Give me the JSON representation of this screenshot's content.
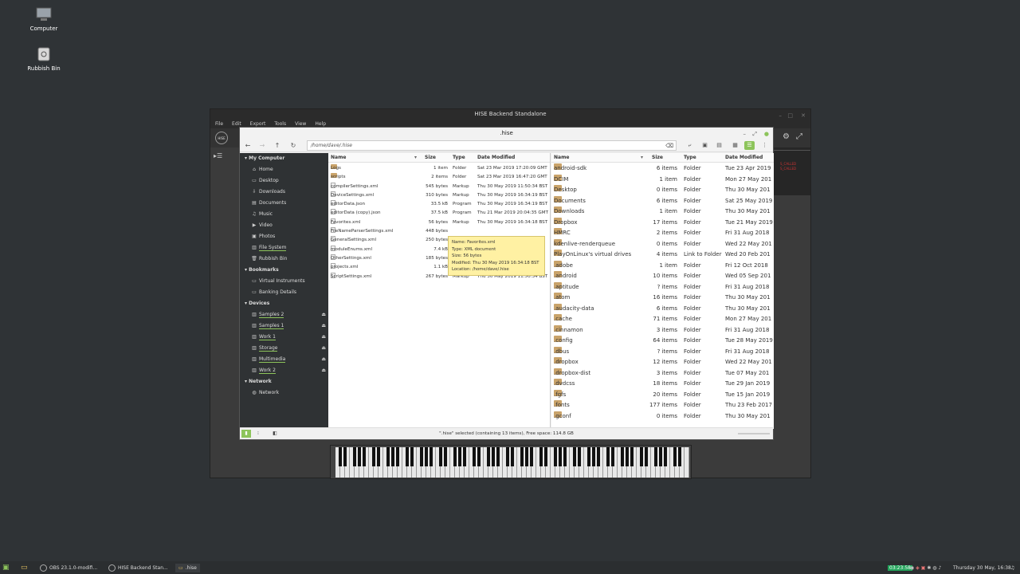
{
  "desktop": {
    "icons": [
      {
        "label": "Computer",
        "icon": "computer-icon"
      },
      {
        "label": "Rubbish Bin",
        "icon": "trash-icon"
      }
    ]
  },
  "hise": {
    "title": "HISE Backend Standalone",
    "menu": [
      "File",
      "Edit",
      "Export",
      "Tools",
      "View",
      "Help"
    ],
    "logo": "HISE",
    "console": [
      "S_CALLED",
      "S_CALLED"
    ]
  },
  "fm": {
    "title": ".hise",
    "location": "/home/dave/.hise",
    "sidebar": {
      "my_computer": "My Computer",
      "places": [
        {
          "label": "Home",
          "icon": "home-icon"
        },
        {
          "label": "Desktop",
          "icon": "desktop-icon"
        },
        {
          "label": "Downloads",
          "icon": "download-icon"
        },
        {
          "label": "Documents",
          "icon": "document-icon"
        },
        {
          "label": "Music",
          "icon": "music-icon"
        },
        {
          "label": "Video",
          "icon": "video-icon"
        },
        {
          "label": "Photos",
          "icon": "photo-icon"
        },
        {
          "label": "File System",
          "icon": "drive-icon"
        },
        {
          "label": "Rubbish Bin",
          "icon": "trash-icon"
        }
      ],
      "bookmarks_head": "Bookmarks",
      "bookmarks": [
        "Virtual Instruments",
        "Banking Details"
      ],
      "devices_head": "Devices",
      "devices": [
        "Samples 2",
        "Samples 1",
        "Work 1",
        "Storage",
        "Multimedia",
        "Work 2"
      ],
      "network_head": "Network",
      "network": [
        "Network"
      ]
    },
    "left_columns": {
      "name": "Name",
      "size": "Size",
      "type": "Type",
      "date": "Date Modified"
    },
    "left_rows": [
      {
        "name": "Logs",
        "size": "1 item",
        "type": "Folder",
        "date": "Sat 23 Mar 2019 17:20:09 GMT",
        "folder": true
      },
      {
        "name": "scripts",
        "size": "2 items",
        "type": "Folder",
        "date": "Sat 23 Mar 2019 16:47:20 GMT",
        "folder": true
      },
      {
        "name": "compilerSettings.xml",
        "size": "545 bytes",
        "type": "Markup",
        "date": "Thu 30 May 2019 11:50:34 BST"
      },
      {
        "name": "DeviceSettings.xml",
        "size": "310 bytes",
        "type": "Markup",
        "date": "Thu 30 May 2019 16:34:19 BST"
      },
      {
        "name": "editorData.json",
        "size": "33.5 kB",
        "type": "Program",
        "date": "Thu 30 May 2019 16:34:19 BST"
      },
      {
        "name": "editorData (copy).json",
        "size": "37.5 kB",
        "type": "Program",
        "date": "Thu 21 Mar 2019 20:04:35 GMT"
      },
      {
        "name": "Favorites.xml",
        "size": "56 bytes",
        "type": "Markup",
        "date": "Thu 30 May 2019 16:34:18 BST"
      },
      {
        "name": "FileNameParserSettings.xml",
        "size": "448 bytes",
        "type": "",
        "date": ""
      },
      {
        "name": "GeneralSettings.xml",
        "size": "250 bytes",
        "type": "",
        "date": ""
      },
      {
        "name": "moduleEnums.xml",
        "size": "7.4 kB",
        "type": "",
        "date": ""
      },
      {
        "name": "OtherSettings.xml",
        "size": "185 bytes",
        "type": "",
        "date": ""
      },
      {
        "name": "projects.xml",
        "size": "1.1 kB",
        "type": "",
        "date": ""
      },
      {
        "name": "ScriptSettings.xml",
        "size": "267 bytes",
        "type": "Markup",
        "date": "Thu 30 May 2019 11:50:34 BST"
      }
    ],
    "tooltip": [
      "Name: Favorites.xml",
      "Type: XML document",
      "Size: 56 bytes",
      "Modified: Thu 30 May 2019 16:34:18 BST",
      "Location: /home/dave/.hise"
    ],
    "right_rows": [
      {
        "name": "android-sdk",
        "size": "6 items",
        "type": "Folder",
        "date": "Tue 23 Apr 2019"
      },
      {
        "name": "DCIM",
        "size": "1 item",
        "type": "Folder",
        "date": "Mon 27 May 201"
      },
      {
        "name": "Desktop",
        "size": "0 items",
        "type": "Folder",
        "date": "Thu 30 May 201"
      },
      {
        "name": "Documents",
        "size": "6 items",
        "type": "Folder",
        "date": "Sat 25 May 2019"
      },
      {
        "name": "Downloads",
        "size": "1 item",
        "type": "Folder",
        "date": "Thu 30 May 201"
      },
      {
        "name": "Dropbox",
        "size": "17 items",
        "type": "Folder",
        "date": "Tue 21 May 2019"
      },
      {
        "name": "HMRC",
        "size": "2 items",
        "type": "Folder",
        "date": "Fri 31 Aug 2018"
      },
      {
        "name": "kdenlive-renderqueue",
        "size": "0 items",
        "type": "Folder",
        "date": "Wed 22 May 201"
      },
      {
        "name": "PlayOnLinux's virtual drives",
        "size": "4 items",
        "type": "Link to Folder",
        "date": "Wed 20 Feb 201"
      },
      {
        "name": ".adobe",
        "size": "1 item",
        "type": "Folder",
        "date": "Fri 12 Oct 2018"
      },
      {
        "name": ".android",
        "size": "10 items",
        "type": "Folder",
        "date": "Wed 05 Sep 201"
      },
      {
        "name": ".aptitude",
        "size": "? items",
        "type": "Folder",
        "date": "Fri 31 Aug 2018"
      },
      {
        "name": ".atom",
        "size": "16 items",
        "type": "Folder",
        "date": "Thu 30 May 201"
      },
      {
        "name": ".audacity-data",
        "size": "6 items",
        "type": "Folder",
        "date": "Thu 30 May 201"
      },
      {
        "name": ".cache",
        "size": "71 items",
        "type": "Folder",
        "date": "Mon 27 May 201"
      },
      {
        "name": ".cinnamon",
        "size": "3 items",
        "type": "Folder",
        "date": "Fri 31 Aug 2018"
      },
      {
        "name": ".config",
        "size": "64 items",
        "type": "Folder",
        "date": "Tue 28 May 2019"
      },
      {
        "name": ".dbus",
        "size": "? items",
        "type": "Folder",
        "date": "Fri 31 Aug 2018"
      },
      {
        "name": ".dropbox",
        "size": "12 items",
        "type": "Folder",
        "date": "Wed 22 May 201"
      },
      {
        "name": ".dropbox-dist",
        "size": "3 items",
        "type": "Folder",
        "date": "Tue 07 May 201"
      },
      {
        "name": ".dvdcss",
        "size": "18 items",
        "type": "Folder",
        "date": "Tue 29 Jan 2019"
      },
      {
        "name": ".fgfs",
        "size": "20 items",
        "type": "Folder",
        "date": "Tue 15 Jan 2019"
      },
      {
        "name": ".fonts",
        "size": "177 items",
        "type": "Folder",
        "date": "Thu 23 Feb 2017"
      },
      {
        "name": ".gconf",
        "size": "0 items",
        "type": "Folder",
        "date": "Thu 30 May 201"
      }
    ],
    "status": "\".hise\" selected (containing 13 items), Free space: 114.8 GB"
  },
  "taskbar": {
    "apps": [
      "OBS 23.1.0-modifi...",
      "HISE Backend Stan...",
      ".hise"
    ],
    "time_badge": "03:23:58",
    "clock": "Thursday 30 May, 16:38"
  },
  "colors": {
    "accent": "#8dc45b",
    "folder": "#c9a36a",
    "tooltip": "#fff1a3"
  }
}
